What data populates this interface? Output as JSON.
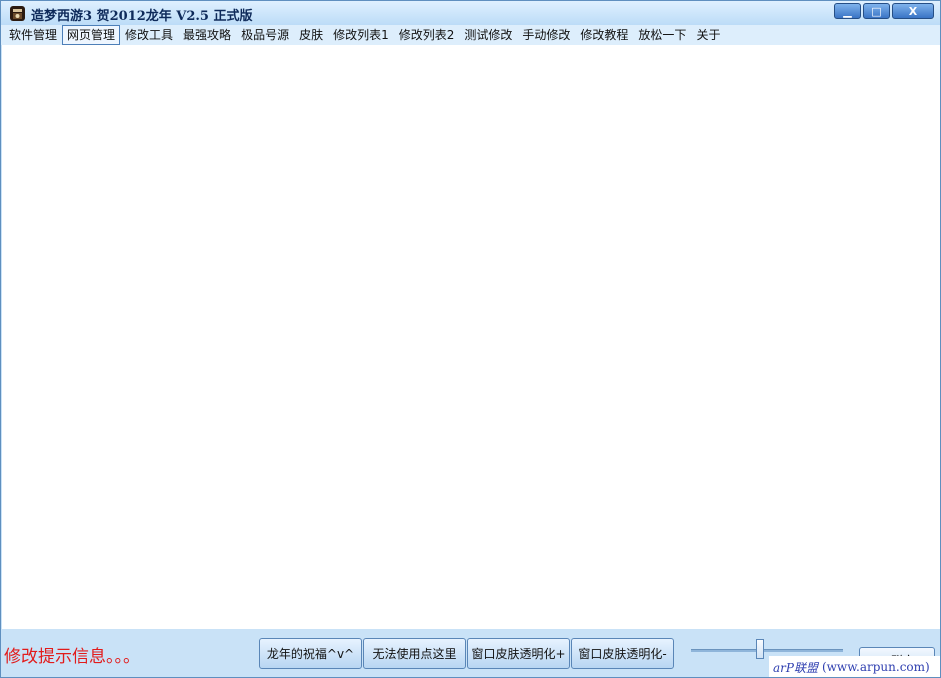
{
  "window": {
    "title": "造梦西游3 贺2012龙年 V2.5 正式版",
    "controls": {
      "minimize": "▁",
      "maximize": "□",
      "close": "X"
    }
  },
  "menu": {
    "items": [
      {
        "label": "软件管理",
        "active": false
      },
      {
        "label": "网页管理",
        "active": true
      },
      {
        "label": "修改工具",
        "active": false
      },
      {
        "label": "最强攻略",
        "active": false
      },
      {
        "label": "极品号源",
        "active": false
      },
      {
        "label": "皮肤",
        "active": false
      },
      {
        "label": "修改列表1",
        "active": false
      },
      {
        "label": "修改列表2",
        "active": false
      },
      {
        "label": "测试修改",
        "active": false
      },
      {
        "label": "手动修改",
        "active": false
      },
      {
        "label": "修改教程",
        "active": false
      },
      {
        "label": "放松一下",
        "active": false
      },
      {
        "label": "关于",
        "active": false
      }
    ]
  },
  "bottom": {
    "status": "修改提示信息。。。",
    "buttons": {
      "blessing": "龙年的祝福^v^",
      "unusable": "无法使用点这里",
      "transparent_plus": "窗口皮肤透明化+",
      "transparent_minus": "窗口皮肤透明化-"
    },
    "slider_value": 0.45,
    "corner_button": "QQ 群交",
    "watermark_brand": "arP联盟",
    "watermark_url": "(www.arpun.com)"
  },
  "colors": {
    "status_text": "#e21b1b",
    "watermark": "#2f3fb0",
    "window_bg": "#c9e2f7"
  }
}
